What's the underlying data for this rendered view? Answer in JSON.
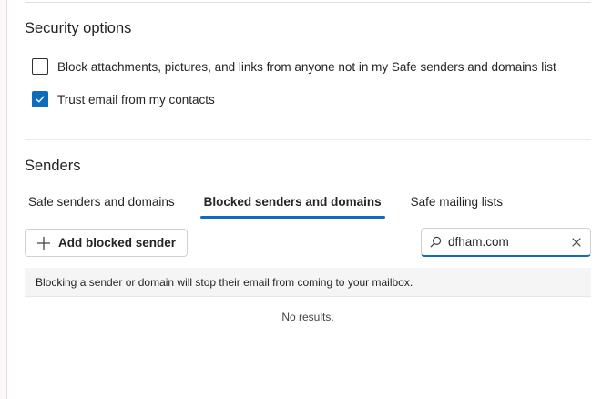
{
  "security_options": {
    "title": "Security options",
    "options": [
      {
        "label": "Block attachments, pictures, and links from anyone not in my Safe senders and domains list",
        "checked": false
      },
      {
        "label": "Trust email from my contacts",
        "checked": true
      }
    ]
  },
  "senders": {
    "title": "Senders",
    "tabs": [
      {
        "label": "Safe senders and domains",
        "selected": false
      },
      {
        "label": "Blocked senders and domains",
        "selected": true
      },
      {
        "label": "Safe mailing lists",
        "selected": false
      }
    ],
    "add_button_label": "Add blocked sender",
    "search": {
      "value": "dfham.com"
    },
    "info_text": "Blocking a sender or domain will stop their email from coming to your mailbox.",
    "empty_text": "No results."
  },
  "colors": {
    "accent": "#0f6cbd",
    "info_bar_bg": "#f5f5f5"
  },
  "icons": {
    "add": "plus-icon",
    "search": "search-icon",
    "clear": "close-icon",
    "check": "checkmark-icon"
  }
}
